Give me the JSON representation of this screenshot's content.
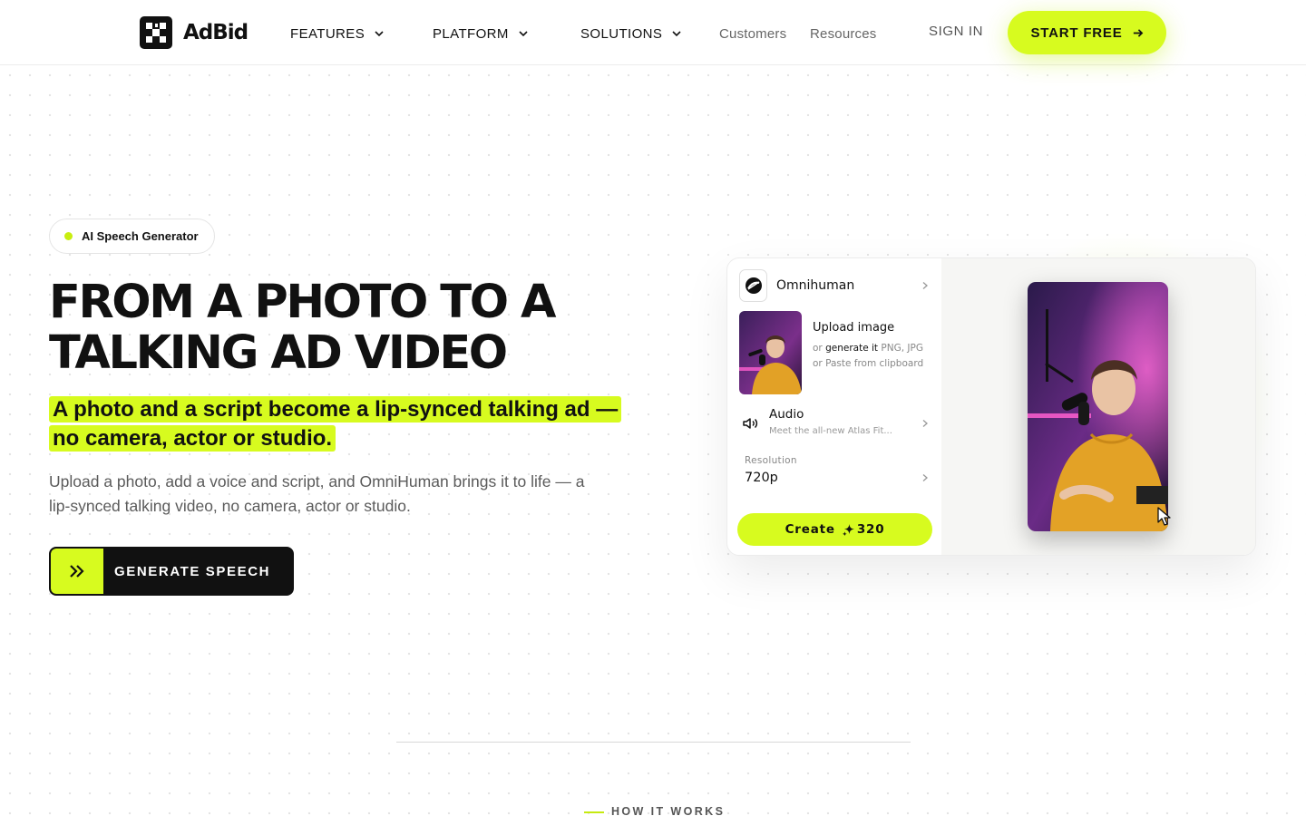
{
  "brand": {
    "name": "AdBid"
  },
  "nav": {
    "features": "FEATURES",
    "platform": "PLATFORM",
    "solutions": "SOLUTIONS",
    "customers": "Customers",
    "resources": "Resources",
    "signin": "SIGN IN",
    "start_free": "START FREE"
  },
  "hero": {
    "badge": "AI Speech Generator",
    "title": "FROM A PHOTO TO A TALKING AD VIDEO",
    "highlight": "A photo and a script become a lip-synced talking ad — no camera, actor or studio.",
    "description": "Upload a photo, add a voice and script, and OmniHuman brings it to life — a lip-synced talking video, no camera, actor or studio.",
    "cta": "GENERATE SPEECH"
  },
  "mockup": {
    "model": "Omnihuman",
    "upload_title": "Upload image",
    "upload_prefix": "or",
    "upload_link": "generate it",
    "upload_rest": "PNG, JPG or Paste from clipboard",
    "audio_title": "Audio",
    "audio_sub": "Meet the all-new Atlas Fit...",
    "resolution_label": "Resolution",
    "resolution_value": "720p",
    "create_label": "Create",
    "credits": "320"
  },
  "section": {
    "how_it_works": "HOW IT WORKS"
  },
  "colors": {
    "accent": "#d7fb1f",
    "dark": "#111111"
  },
  "icons": [
    "logo-mark-icon",
    "chevron-down-icon",
    "arrow-right-icon",
    "double-chevron-right-icon",
    "model-logo-icon",
    "chevron-right-icon",
    "speaker-icon",
    "sparkle-icon",
    "cursor-icon"
  ]
}
